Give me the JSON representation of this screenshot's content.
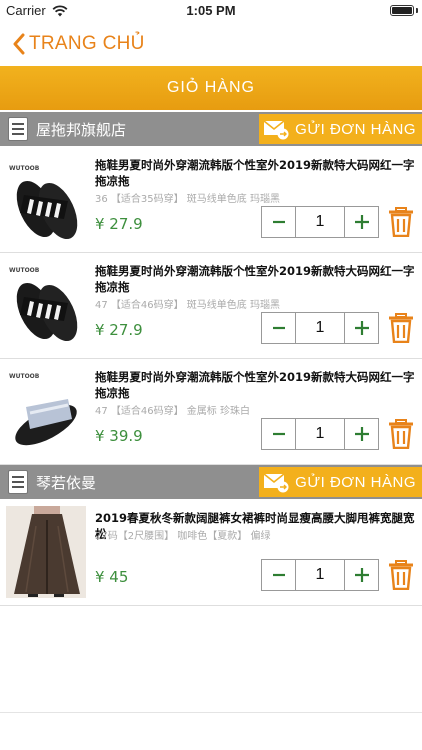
{
  "status_bar": {
    "carrier": "Carrier",
    "time": "1:05 PM"
  },
  "nav": {
    "back_label": "TRANG CHỦ"
  },
  "cart": {
    "title": "GIỎ HÀNG"
  },
  "send_order_label": "GỬI ĐƠN HÀNG",
  "currency": "¥",
  "stores": [
    {
      "name": "屋拖邦旗舰店",
      "products": [
        {
          "title": "拖鞋男夏时尚外穿潮流韩版个性室外2019新款特大码网红一字拖凉拖",
          "spec": "36 【适合35码穿】 斑马线单色底 玛瑙黑",
          "price": "¥ 27.9",
          "quantity": "1",
          "brand": "WUTOOB"
        },
        {
          "title": "拖鞋男夏时尚外穿潮流韩版个性室外2019新款特大码网红一字拖凉拖",
          "spec": "47 【适合46码穿】 斑马线单色底 玛瑙黑",
          "price": "¥ 27.9",
          "quantity": "1",
          "brand": "WUTOOB"
        },
        {
          "title": "拖鞋男夏时尚外穿潮流韩版个性室外2019新款特大码网红一字拖凉拖",
          "spec": "47 【适合46码穿】 金属标 珍珠白",
          "price": "¥ 39.9",
          "quantity": "1",
          "brand": "WUTOOB"
        }
      ]
    },
    {
      "name": "琴若依曼",
      "products": [
        {
          "title": "2019春夏秋冬新款阔腿裤女裙裤时尚显瘦高腰大脚甩裤宽腿宽松",
          "spec": "27码【2尺腰围】 咖啡色【夏款】 偏绿",
          "price": "¥ 45",
          "quantity": "1"
        }
      ]
    }
  ],
  "colors": {
    "accent": "#e8831a",
    "cart_bar": "#efa815",
    "store_bar": "#8f8f8f",
    "price": "#3d8f3d"
  },
  "icons": [
    "wifi-icon",
    "battery-icon",
    "chevron-left-icon",
    "list-icon",
    "mail-send-icon",
    "minus-icon",
    "plus-icon",
    "trash-icon"
  ]
}
